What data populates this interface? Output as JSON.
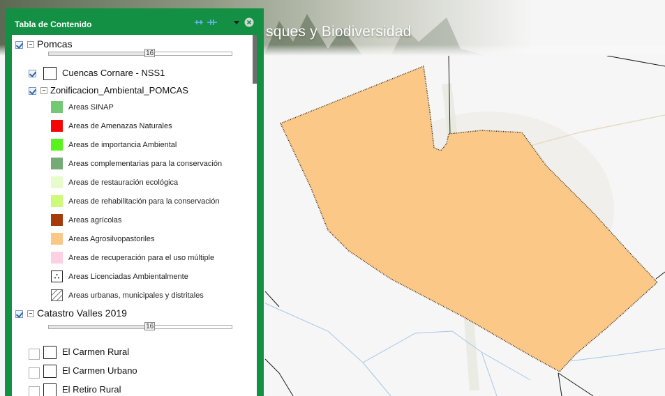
{
  "banner": {
    "title": "sques y Biodiversidad"
  },
  "map": {
    "area_label": ""
  },
  "toc": {
    "title": "Tabla de Contenido",
    "tools": [
      "collapse-all-icon",
      "expand-all-icon",
      "menu-dropdown-icon",
      "close-icon"
    ],
    "groups": [
      {
        "name": "Pomcas",
        "checked": true,
        "transparency": {
          "value": "16",
          "level": 0.55
        },
        "sublayers": [
          {
            "name": "Cuencas Cornare - NSS1",
            "checked": true
          },
          {
            "name": "Zonificacion_Ambiental_POMCAS",
            "checked": true
          }
        ],
        "legend": [
          {
            "label": "Areas SINAP",
            "color": "#73c973"
          },
          {
            "label": "Areas de Amenazas Naturales",
            "color": "#f50505"
          },
          {
            "label": "Areas de importancia Ambiental",
            "color": "#58f21c"
          },
          {
            "label": "Areas complementarias para la conservación",
            "color": "#75ab75"
          },
          {
            "label": "Areas de restauración ecológica",
            "color": "#e8fbcb"
          },
          {
            "label": "Areas de rehabilitación para la conservación",
            "color": "#cdfa7a"
          },
          {
            "label": "Areas agrícolas",
            "color": "#a63a0a"
          },
          {
            "label": "Areas Agrosilvopastoriles",
            "color": "#fcc887"
          },
          {
            "label": "Areas de recuperación para el uso múltiple",
            "color": "#fdd0e2"
          },
          {
            "label": "Areas Licenciadas Ambientalmente",
            "color": "#ffffff",
            "pattern": "dots"
          },
          {
            "label": "Areas urbanas, municipales y distritales",
            "color": "#ffffff",
            "pattern": "hatch"
          }
        ]
      },
      {
        "name": "Catastro Valles 2019",
        "checked": true,
        "transparency": {
          "value": "16",
          "level": 0.55
        },
        "sublayers": [
          {
            "name": "El Carmen Rural",
            "checked": false
          },
          {
            "name": "El Carmen Urbano",
            "checked": false
          },
          {
            "name": "El Retiro Rural",
            "checked": false
          }
        ]
      }
    ]
  },
  "colors": {
    "panel_green": "#139043",
    "polygon_fill": "#fcc887",
    "map_background": "#f6f6f6"
  }
}
